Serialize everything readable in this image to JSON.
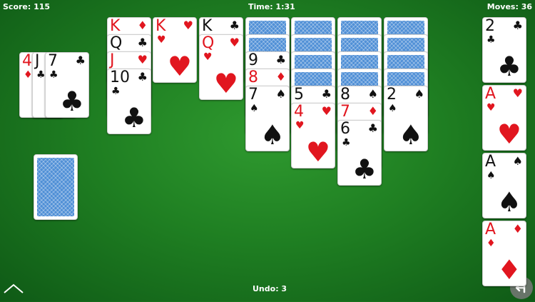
{
  "hud": {
    "score": "Score: 115",
    "time": "Time: 1:31",
    "moves": "Moves: 36",
    "undo": "Undo: 3"
  },
  "suits": {
    "hearts": "♥",
    "diamonds": "♦",
    "clubs": "♣",
    "spades": "♠"
  },
  "waste": [
    {
      "rank": "4",
      "suit": "diamonds"
    },
    {
      "rank": "J",
      "suit": "clubs"
    },
    {
      "rank": "7",
      "suit": "clubs"
    }
  ],
  "columns": [
    [
      {
        "rank": "K",
        "suit": "diamonds"
      },
      {
        "rank": "Q",
        "suit": "clubs"
      },
      {
        "rank": "J",
        "suit": "hearts"
      },
      {
        "rank": "10",
        "suit": "clubs"
      }
    ],
    [
      {
        "rank": "K",
        "suit": "hearts"
      }
    ],
    [
      {
        "rank": "K",
        "suit": "clubs"
      },
      {
        "rank": "Q",
        "suit": "hearts"
      }
    ],
    [
      "back",
      "back",
      {
        "rank": "9",
        "suit": "clubs"
      },
      {
        "rank": "8",
        "suit": "diamonds"
      },
      {
        "rank": "7",
        "suit": "spades"
      }
    ],
    [
      "back",
      "back",
      "back",
      "back",
      {
        "rank": "5",
        "suit": "clubs"
      },
      {
        "rank": "4",
        "suit": "hearts"
      }
    ],
    [
      "back",
      "back",
      "back",
      "back",
      {
        "rank": "8",
        "suit": "spades"
      },
      {
        "rank": "7",
        "suit": "diamonds"
      },
      {
        "rank": "6",
        "suit": "clubs"
      }
    ],
    [
      "back",
      "back",
      "back",
      "back",
      {
        "rank": "2",
        "suit": "spades"
      }
    ]
  ],
  "foundations": [
    {
      "rank": "2",
      "suit": "clubs"
    },
    {
      "rank": "A",
      "suit": "hearts"
    },
    {
      "rank": "A",
      "suit": "spades"
    },
    {
      "rank": "A",
      "suit": "diamonds"
    }
  ],
  "controls": {
    "menu_icon": "chevron-up-icon",
    "undo_icon": "undo-arrow-icon"
  }
}
